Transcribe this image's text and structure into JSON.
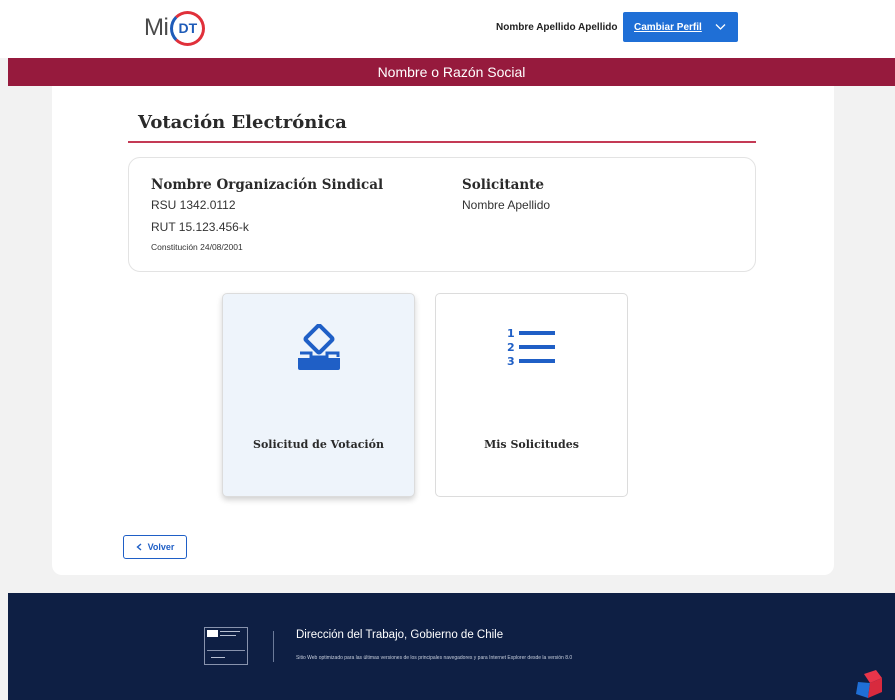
{
  "header": {
    "logo_mi": "Mi",
    "logo_dt": "DT",
    "user_name": "Nombre Apellido Apellido",
    "profile_button": "Cambiar Perfil",
    "razon_social": "Nombre o Razón Social"
  },
  "page": {
    "title": "Votación Electrónica"
  },
  "organization": {
    "name": "Nombre Organización Sindical",
    "rsu": "RSU 1342.0112",
    "rut": "RUT 15.123.456-k",
    "constitucion": "Constitución 24/08/2001"
  },
  "solicitante": {
    "title": "Solicitante",
    "name": "Nombre Apellido"
  },
  "tiles": [
    {
      "label": "Solicitud de Votación",
      "icon": "ballot-box-icon"
    },
    {
      "label": "Mis Solicitudes",
      "icon": "numbered-list-icon"
    }
  ],
  "back_button": "Volver",
  "footer": {
    "title": "Dirección del Trabajo, Gobierno de Chile",
    "note": "Sitio Web optimizado para las últimas versiones de los principales navegadores y para Internet Explorer desde la versión 8.0"
  },
  "colors": {
    "primary_blue": "#1f6fd6",
    "brand_red": "#961a3d",
    "title_rule": "#c43a55",
    "footer_navy": "#0e1f44",
    "icon_blue": "#1f5fc6"
  }
}
